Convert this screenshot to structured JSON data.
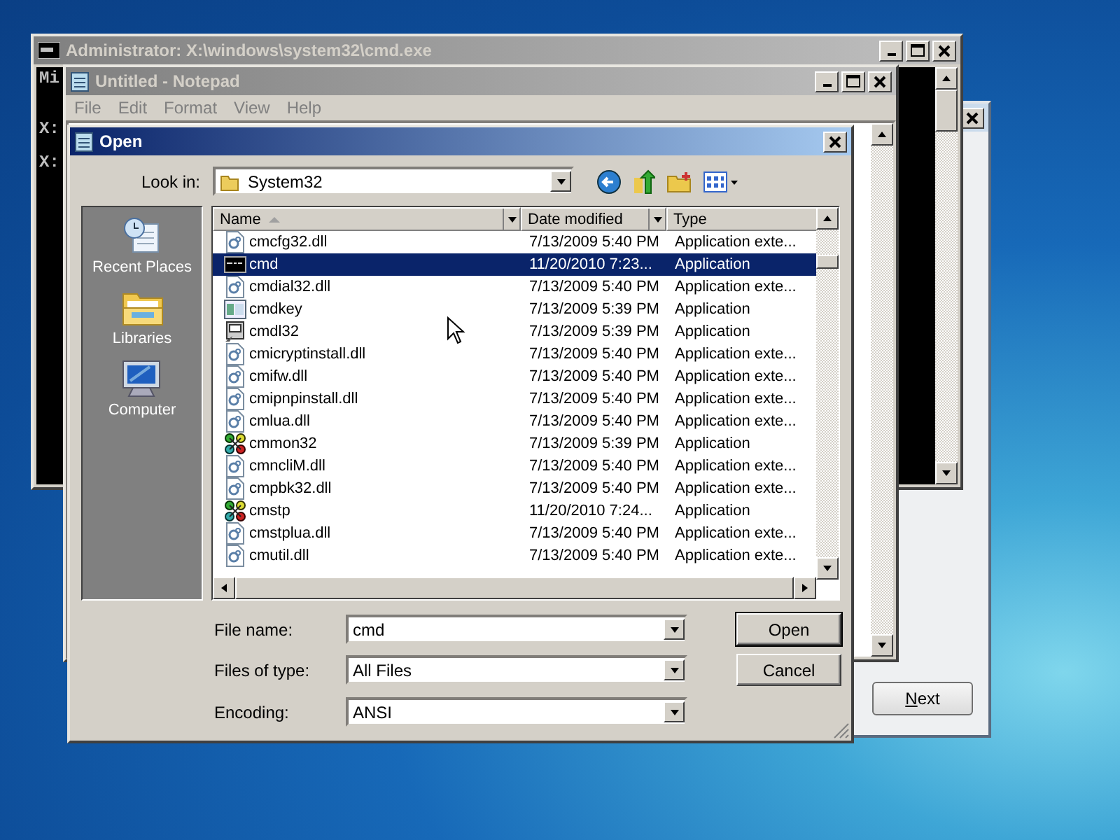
{
  "cmd_window": {
    "title": "Administrator: X:\\windows\\system32\\cmd.exe",
    "lines": [
      "Mi",
      "X:",
      "X:"
    ]
  },
  "notepad_window": {
    "title": "Untitled - Notepad",
    "menu": [
      "File",
      "Edit",
      "Format",
      "View",
      "Help"
    ]
  },
  "setup_window": {
    "next_button": "Next"
  },
  "open_dialog": {
    "title": "Open",
    "look_in": {
      "label": "Look in:",
      "value": "System32"
    },
    "places": [
      {
        "label": "Recent Places",
        "kind": "recent"
      },
      {
        "label": "Libraries",
        "kind": "libraries"
      },
      {
        "label": "Computer",
        "kind": "computer"
      }
    ],
    "columns": [
      "Name",
      "Date modified",
      "Type"
    ],
    "files": [
      {
        "name": "cmcfg32.dll",
        "date": "7/13/2009 5:40 PM",
        "type": "Application exte...",
        "kind": "dll",
        "selected": false
      },
      {
        "name": "cmd",
        "date": "11/20/2010 7:23...",
        "type": "Application",
        "kind": "console",
        "selected": true
      },
      {
        "name": "cmdial32.dll",
        "date": "7/13/2009 5:40 PM",
        "type": "Application exte...",
        "kind": "dll",
        "selected": false
      },
      {
        "name": "cmdkey",
        "date": "7/13/2009 5:39 PM",
        "type": "Application",
        "kind": "app",
        "selected": false
      },
      {
        "name": "cmdl32",
        "date": "7/13/2009 5:39 PM",
        "type": "Application",
        "kind": "tool",
        "selected": false
      },
      {
        "name": "cmicryptinstall.dll",
        "date": "7/13/2009 5:40 PM",
        "type": "Application exte...",
        "kind": "dll",
        "selected": false
      },
      {
        "name": "cmifw.dll",
        "date": "7/13/2009 5:40 PM",
        "type": "Application exte...",
        "kind": "dll",
        "selected": false
      },
      {
        "name": "cmipnpinstall.dll",
        "date": "7/13/2009 5:40 PM",
        "type": "Application exte...",
        "kind": "dll",
        "selected": false
      },
      {
        "name": "cmlua.dll",
        "date": "7/13/2009 5:40 PM",
        "type": "Application exte...",
        "kind": "dll",
        "selected": false
      },
      {
        "name": "cmmon32",
        "date": "7/13/2009 5:39 PM",
        "type": "Application",
        "kind": "cluster",
        "selected": false
      },
      {
        "name": "cmncliM.dll",
        "date": "7/13/2009 5:40 PM",
        "type": "Application exte...",
        "kind": "dll",
        "selected": false
      },
      {
        "name": "cmpbk32.dll",
        "date": "7/13/2009 5:40 PM",
        "type": "Application exte...",
        "kind": "dll",
        "selected": false
      },
      {
        "name": "cmstp",
        "date": "11/20/2010 7:24...",
        "type": "Application",
        "kind": "cluster",
        "selected": false
      },
      {
        "name": "cmstplua.dll",
        "date": "7/13/2009 5:40 PM",
        "type": "Application exte...",
        "kind": "dll",
        "selected": false
      },
      {
        "name": "cmutil.dll",
        "date": "7/13/2009 5:40 PM",
        "type": "Application exte...",
        "kind": "dll",
        "selected": false
      }
    ],
    "file_name": {
      "label": "File name:",
      "value": "cmd"
    },
    "files_of_type": {
      "label": "Files of type:",
      "value": "All Files"
    },
    "encoding": {
      "label": "Encoding:",
      "value": "ANSI"
    },
    "buttons": [
      "Open",
      "Cancel"
    ]
  }
}
